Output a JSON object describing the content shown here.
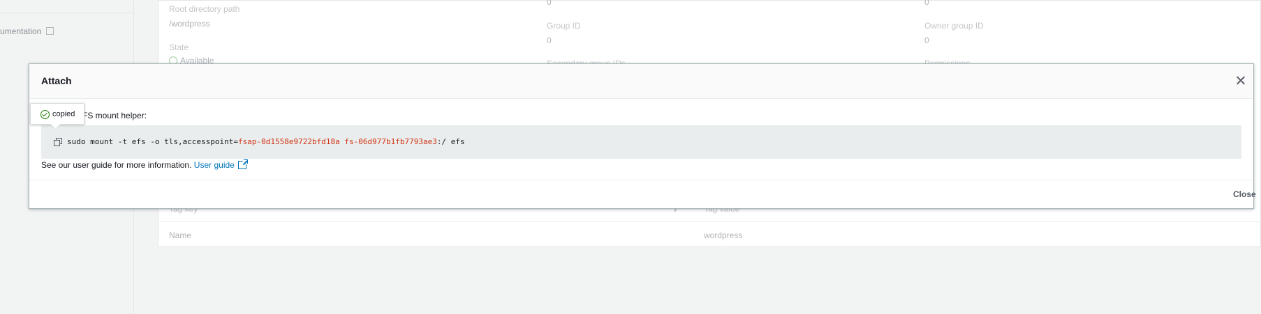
{
  "background": {
    "sidebar_link": "umentation",
    "fields": {
      "root_directory_label": "Root directory path",
      "root_directory_value": "/wordpress",
      "state_label": "State",
      "state_value": "Available",
      "top_value_mid": "0",
      "top_value_right": "0",
      "group_id_label": "Group ID",
      "group_id_value": "0",
      "owner_group_id_label": "Owner group ID",
      "owner_group_id_value": "0",
      "secondary_group_ids_label": "Secondary group IDs",
      "permissions_label": "Permissions"
    },
    "tags_table": {
      "headers": [
        "Tag key",
        "Tag value"
      ],
      "rows": [
        [
          "Name",
          "wordpress"
        ]
      ]
    }
  },
  "modal": {
    "title": "Attach",
    "instruction": "Using the EFS mount helper:",
    "instruction_visible": "FS mount helper:",
    "command": {
      "prefix": "sudo mount -t efs -o tls,accesspoint=",
      "access_point_id": "fsap-0d1558e9722bfd18a",
      "separator": " ",
      "file_system_id": "fs-06d977b1fb7793ae3",
      "suffix": ":/ efs"
    },
    "guide_text": "See our user guide for more information.",
    "guide_link": "User guide",
    "close_button": "Close"
  },
  "tooltip": {
    "text": "copied"
  },
  "icons": {
    "close": "close-icon",
    "copy": "copy-icon",
    "external_link": "external-link-icon",
    "success": "success-check-icon"
  },
  "colors": {
    "link": "#0073bb",
    "code_highlight": "#d13212",
    "success": "#1d8102",
    "code_background": "#eaeded"
  }
}
